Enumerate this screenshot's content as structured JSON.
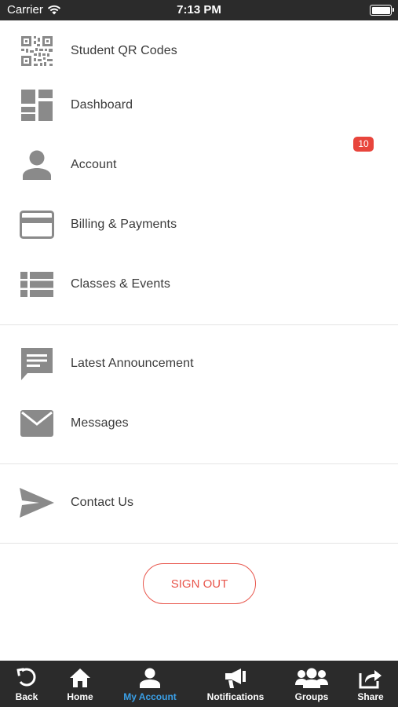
{
  "status_bar": {
    "carrier": "Carrier",
    "time": "7:13 PM"
  },
  "menu": {
    "items": [
      {
        "label": "Student QR Codes",
        "icon": "qr-code-icon"
      },
      {
        "label": "Dashboard",
        "icon": "dashboard-icon"
      },
      {
        "label": "Account",
        "icon": "person-icon",
        "badge": "10"
      },
      {
        "label": "Billing & Payments",
        "icon": "credit-card-icon"
      },
      {
        "label": "Classes & Events",
        "icon": "list-icon"
      },
      {
        "label": "Latest Announcement",
        "icon": "announcement-icon"
      },
      {
        "label": "Messages",
        "icon": "envelope-icon"
      },
      {
        "label": "Contact Us",
        "icon": "send-icon"
      }
    ]
  },
  "sign_out_label": "SIGN OUT",
  "tab_bar": {
    "tabs": [
      {
        "label": "Back",
        "icon": "back-icon"
      },
      {
        "label": "Home",
        "icon": "home-icon"
      },
      {
        "label": "My Account",
        "icon": "account-icon",
        "active": true
      },
      {
        "label": "Notifications",
        "icon": "megaphone-icon"
      },
      {
        "label": "Groups",
        "icon": "groups-icon"
      },
      {
        "label": "Share",
        "icon": "share-icon"
      }
    ]
  },
  "colors": {
    "accent_red": "#e8564c",
    "badge_red": "#e8453c",
    "active_tab_blue": "#3aa0e8",
    "bar_dark": "#2b2b2b",
    "icon_gray": "#8a8a8a"
  }
}
